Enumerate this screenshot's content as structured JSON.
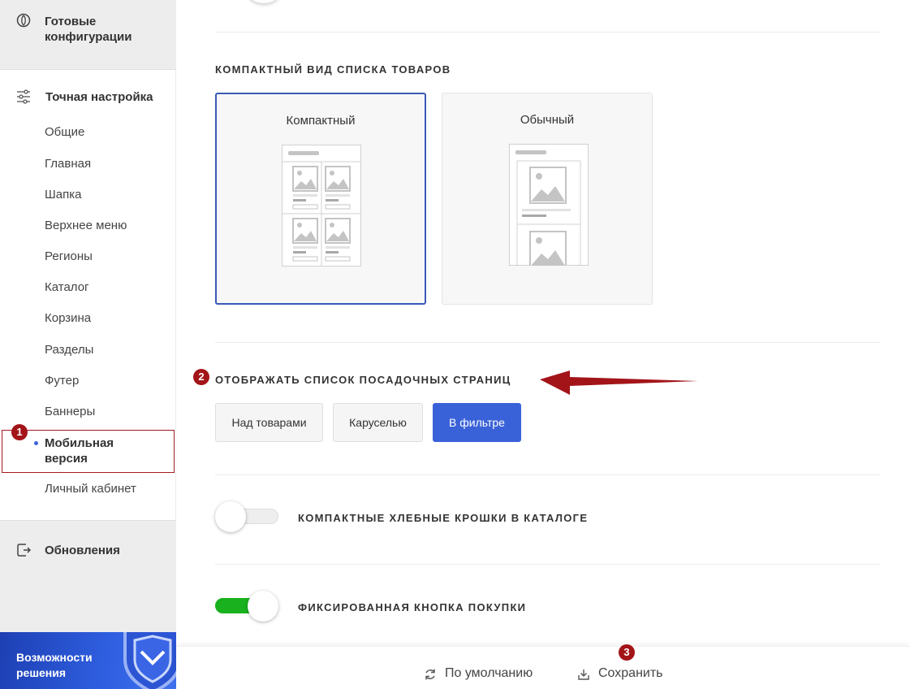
{
  "sidebar": {
    "ready_configs": "Готовые конфигурации",
    "fine_tuning": "Точная настройка",
    "items": [
      "Общие",
      "Главная",
      "Шапка",
      "Верхнее меню",
      "Регионы",
      "Каталог",
      "Корзина",
      "Разделы",
      "Футер",
      "Баннеры"
    ],
    "active_item": "Мобильная версия",
    "after_active_item": "Личный кабинет",
    "updates": "Обновления",
    "banner_text": "Возможности решения"
  },
  "badges": {
    "one": "1",
    "two": "2",
    "three": "3"
  },
  "sections": {
    "compact_list_title": "КОМПАКТНЫЙ ВИД СПИСКА ТОВАРОВ",
    "view_options": [
      {
        "label": "Компактный",
        "selected": true
      },
      {
        "label": "Обычный",
        "selected": false
      }
    ],
    "landing_pages_title": "ОТОБРАЖАТЬ СПИСОК ПОСАДОЧНЫХ СТРАНИЦ",
    "landing_options": [
      {
        "label": "Над товарами",
        "active": false
      },
      {
        "label": "Каруселью",
        "active": false
      },
      {
        "label": "В фильтре",
        "active": true
      }
    ],
    "compact_breadcrumbs": {
      "label": "КОМПАКТНЫЕ ХЛЕБНЫЕ КРОШКИ В КАТАЛОГЕ",
      "on": false
    },
    "fixed_buy_button": {
      "label": "ФИКСИРОВАННАЯ КНОПКА ПОКУПКИ",
      "on": true
    }
  },
  "bottom_bar": {
    "default_label": "По умолчанию",
    "save_label": "Сохранить"
  },
  "colors": {
    "accent": "#3a62d8",
    "toggle_on": "#19b21e",
    "annotation": "#a31419"
  }
}
